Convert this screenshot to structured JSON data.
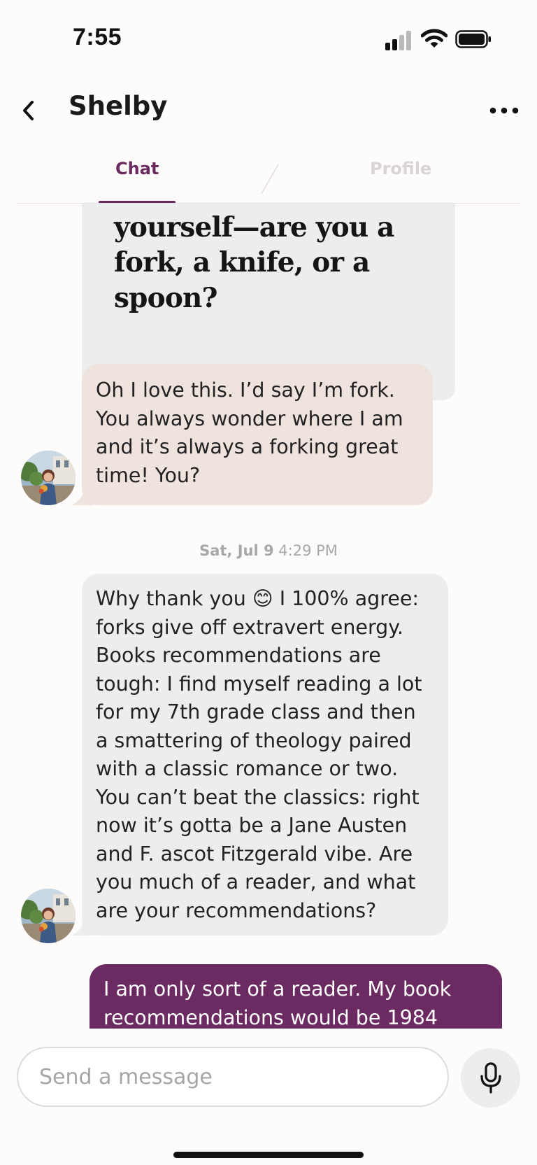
{
  "status_bar": {
    "time": "7:55",
    "signal_icon": "cellular-signal-icon",
    "wifi_icon": "wifi-icon",
    "battery_icon": "battery-icon"
  },
  "header": {
    "back_icon": "chevron-left-icon",
    "contact_name": "Shelby",
    "more_icon": "more-horizontal-icon",
    "tabs": [
      {
        "label": "Chat",
        "active": true
      },
      {
        "label": "Profile",
        "active": false
      }
    ]
  },
  "colors": {
    "accent": "#6a2a60",
    "sent_bubble": "#6b2a61",
    "received_bubble": "#ededed",
    "reply_bubble": "#efe3de",
    "inactive_tab": "#d8d3d6"
  },
  "prompt_card": {
    "lines": [
      "yourself—are you a",
      "fork, a knife, or a",
      "spoon?"
    ]
  },
  "messages": [
    {
      "type": "received",
      "lines": [
        "Oh I love this. I’d say I’m fork.",
        "You always wonder where I am",
        "and it’s always a forking great",
        "time! You?"
      ]
    },
    {
      "type": "timestamp",
      "date": "Sat, Jul 9",
      "time": "4:29 PM"
    },
    {
      "type": "received",
      "lines": [
        "Why thank you 😊 I 100% agree:",
        "forks give off extravert energy.",
        "Books recommendations are",
        "tough: I find myself reading a lot",
        "for my 7th grade class and then",
        "a smattering of theology paired",
        "with a classic romance or two.",
        "You can’t beat the classics: right",
        "now it’s gotta be a Jane Austen",
        "and F. ascot Fitzgerald vibe. Are",
        "you much of a reader, and what",
        "are your recommendations?"
      ]
    },
    {
      "type": "sent",
      "lines": [
        "I am only sort of a reader. My book",
        "recommendations would be 1984"
      ]
    }
  ],
  "composer": {
    "placeholder": "Send a message",
    "mic_icon": "microphone-icon"
  }
}
